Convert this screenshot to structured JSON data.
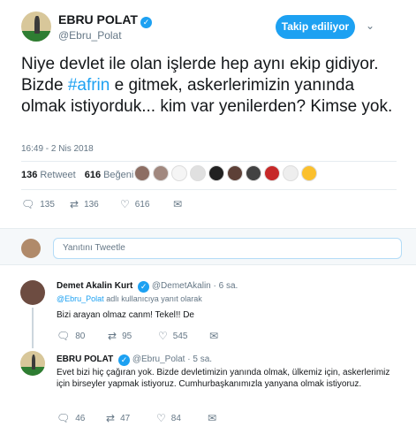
{
  "tweet": {
    "author_name": "EBRU POLAT",
    "author_handle": "@Ebru_Polat",
    "follow_label": "Takip ediliyor",
    "text_before": "Niye devlet ile olan işlerde hep aynı ekip gidiyor. Bizde ",
    "hashtag": "#afrin",
    "text_after": " e gitmek, askerlerimizin yanında olmak istiyorduk... kim var yenilerden? Kimse yok.",
    "time": "16:49 - 2 Nis 2018",
    "retweet_count": "136",
    "retweet_label": "Retweet",
    "like_count": "616",
    "like_label": "Beğeni",
    "actions": {
      "replies": "135",
      "retweets": "136",
      "likes": "616"
    }
  },
  "reply_box": {
    "placeholder": "Yanıtını Tweetle"
  },
  "replies": [
    {
      "name": "Demet Akalin Kurt",
      "handle": "@DemetAkalin",
      "time": "· 6 sa.",
      "replying_to_handle": "@Ebru_Polat",
      "replying_to_suffix": "adlı kullanıcıya yanıt olarak",
      "text": "Bizi arayan olmaz canm! Tekel!! De",
      "actions": {
        "replies": "80",
        "retweets": "95",
        "likes": "545"
      }
    },
    {
      "name": "EBRU POLAT",
      "handle": "@Ebru_Polat",
      "time": "· 5 sa.",
      "text": "Evet bizi hiç çağıran yok. Bizde devletimizin yanında olmak, ülkemiz için, askerlerimiz için birseyler yapmak istiyoruz. Cumhurbaşkanımızla yanyana olmak istiyoruz.",
      "actions": {
        "replies": "46",
        "retweets": "47",
        "likes": "84"
      }
    }
  ],
  "icons": {
    "reply": "reply-icon",
    "retweet": "retweet-icon",
    "like": "heart-icon",
    "dm": "envelope-icon",
    "verified": "verified-badge-icon",
    "caret": "chevron-down-icon"
  },
  "colors": {
    "accent": "#1da1f2",
    "text": "#14171a",
    "muted": "#657786"
  }
}
